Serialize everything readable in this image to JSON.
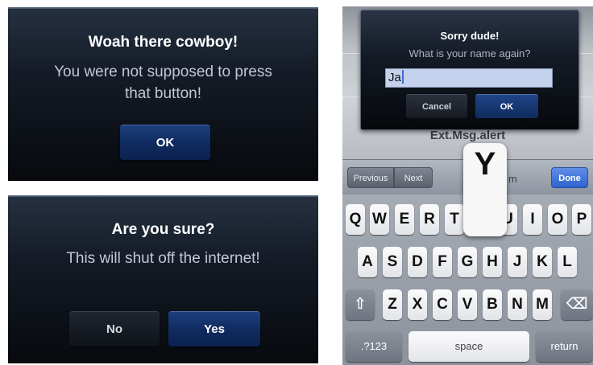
{
  "left_dialogs": [
    {
      "title": "Woah there cowboy!",
      "message_line1": "You were not supposed to press",
      "message_line2": "that button!",
      "buttons": {
        "ok": "OK"
      }
    },
    {
      "title": "Are you sure?",
      "message": "This will shut off the internet!",
      "buttons": {
        "no": "No",
        "yes": "Yes"
      }
    }
  ],
  "phone": {
    "prompt": {
      "title": "Sorry dude!",
      "message": "What is your name again?",
      "input_value": "Ja",
      "cancel_label": "Cancel",
      "ok_label": "OK"
    },
    "background_label": "Ext.Msg.alert",
    "toolbar": {
      "previous_label": "Previous",
      "next_label": "Next",
      "done_label": "Done",
      "partial_text": "m"
    },
    "key_popup": "Y",
    "keyboard": {
      "row1": [
        "Q",
        "W",
        "E",
        "R",
        "T",
        "U",
        "I",
        "O",
        "P"
      ],
      "row2": [
        "A",
        "S",
        "D",
        "F",
        "G",
        "H",
        "J",
        "K",
        "L"
      ],
      "row3": [
        "Z",
        "X",
        "C",
        "V",
        "B",
        "N",
        "M"
      ],
      "numbers_label": ".?123",
      "space_label": "space",
      "return_label": "return",
      "shift_glyph": "⇧",
      "delete_glyph": "⌫"
    },
    "colors": {
      "dialog_blue": "#0f2a5e",
      "done_blue": "#2e62d0",
      "input_highlight": "#c5d2ee"
    }
  }
}
